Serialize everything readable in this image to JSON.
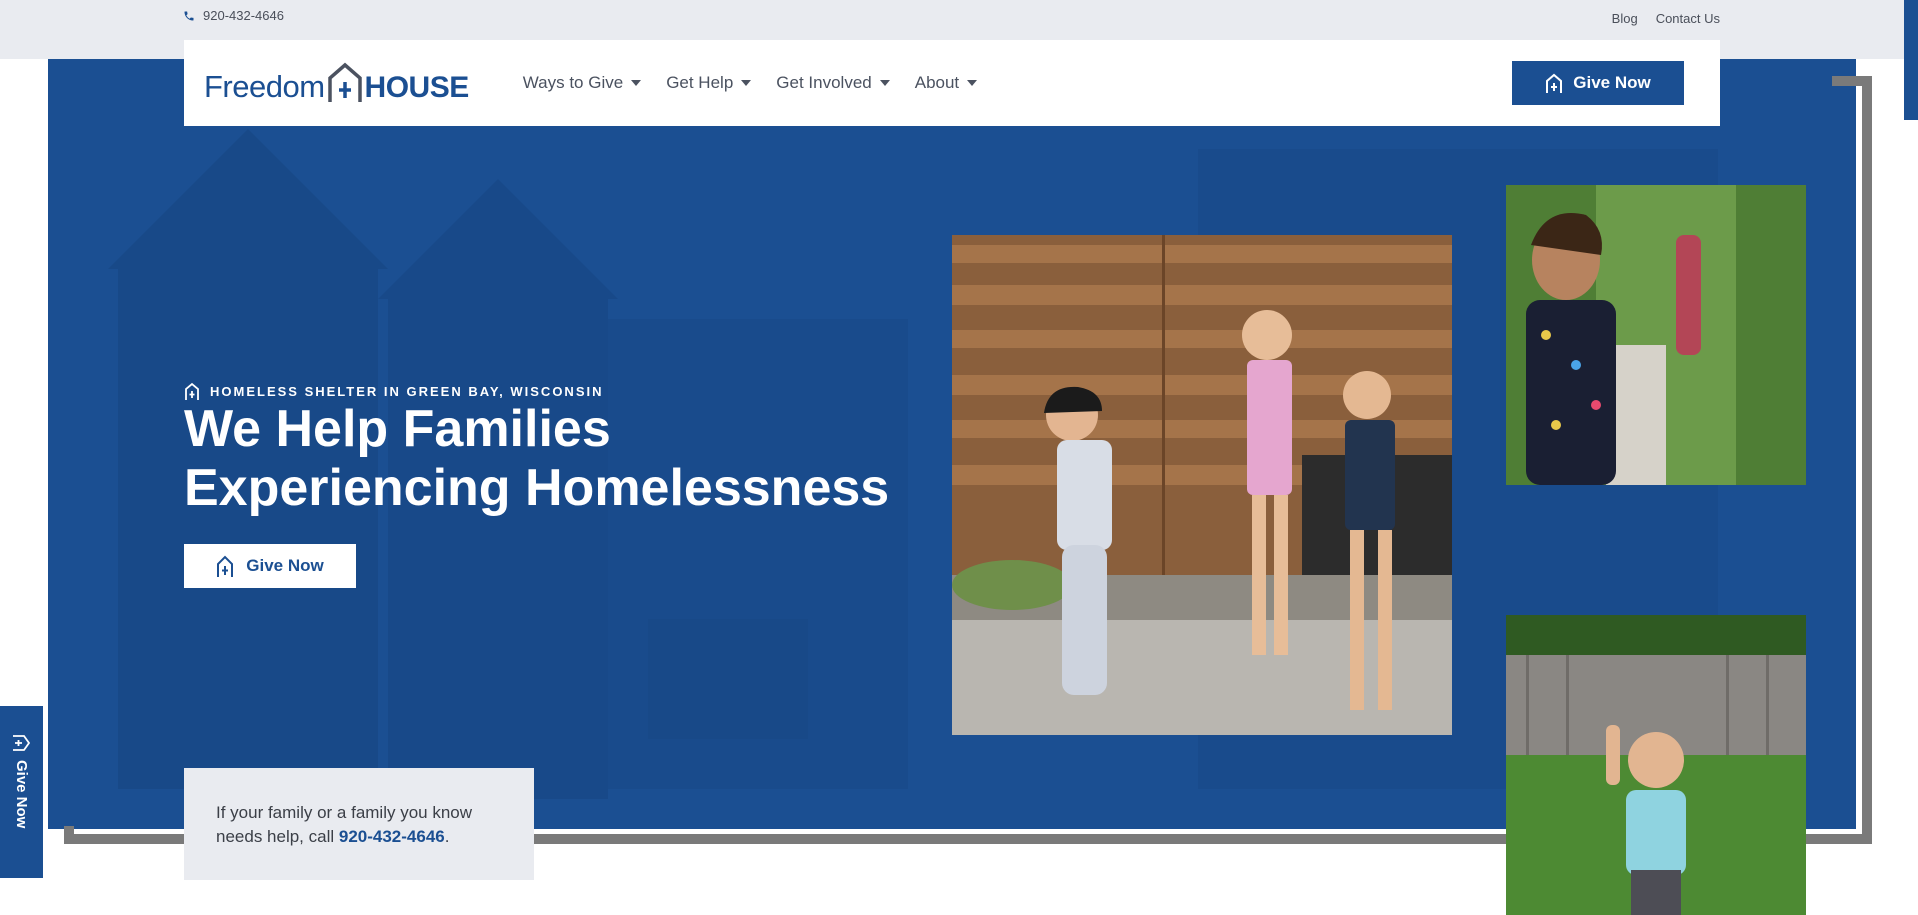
{
  "topbar": {
    "phone": "920-432-4646",
    "links": [
      "Blog",
      "Contact Us"
    ]
  },
  "brand": {
    "name_part1": "Freedom",
    "name_part2": "HOUSE",
    "color": "#1b4f92"
  },
  "nav": {
    "items": [
      {
        "label": "Ways to Give"
      },
      {
        "label": "Get Help"
      },
      {
        "label": "Get Involved"
      },
      {
        "label": "About"
      }
    ],
    "cta": "Give Now"
  },
  "hero": {
    "eyebrow": "HOMELESS SHELTER IN GREEN BAY, WISCONSIN",
    "headline_line1": "We Help Families",
    "headline_line2": "Experiencing Homelessness",
    "cta": "Give Now",
    "background_color": "#1b4f92"
  },
  "help": {
    "text_before": "If your family or a family you know needs help, call ",
    "phone": "920-432-4646",
    "text_after": "."
  },
  "side_tab": {
    "label": "Give Now"
  }
}
